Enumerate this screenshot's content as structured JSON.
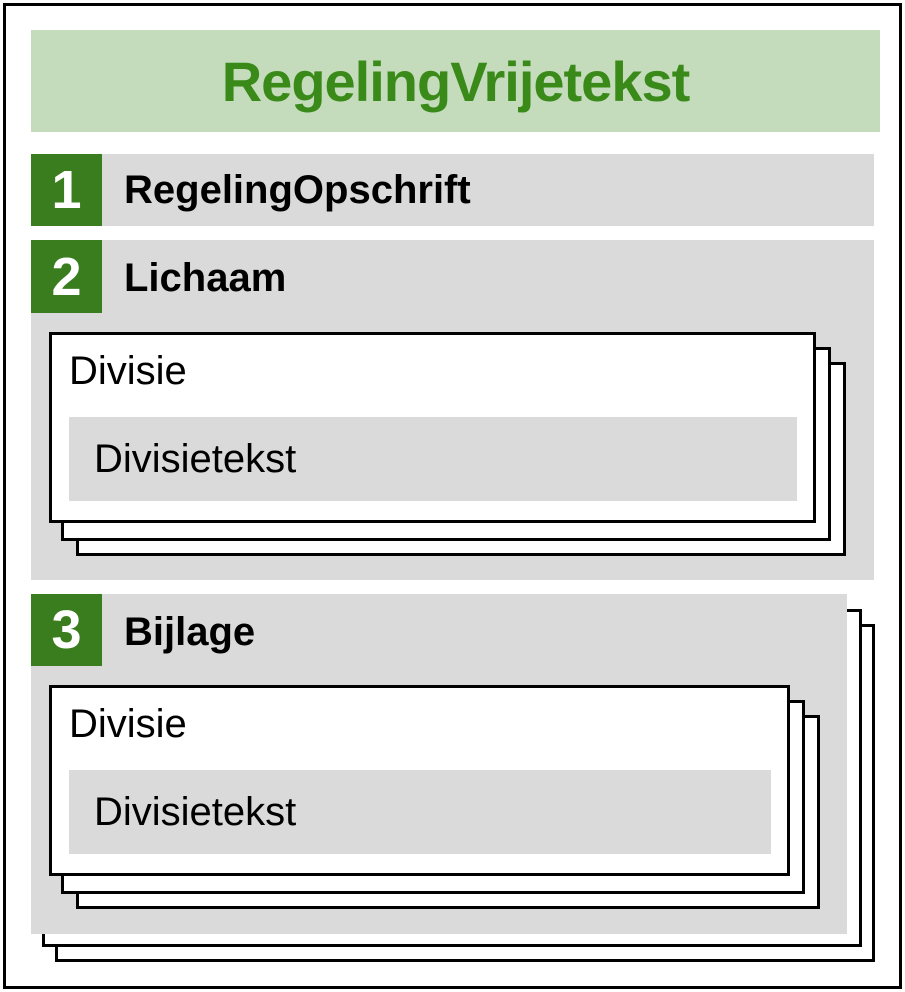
{
  "title": "RegelingVrijetekst",
  "sections": [
    {
      "number": "1",
      "label": "RegelingOpschrift"
    },
    {
      "number": "2",
      "label": "Lichaam",
      "divisie": {
        "label": "Divisie",
        "inner": "Divisietekst"
      }
    },
    {
      "number": "3",
      "label": "Bijlage",
      "divisie": {
        "label": "Divisie",
        "inner": "Divisietekst"
      }
    }
  ]
}
